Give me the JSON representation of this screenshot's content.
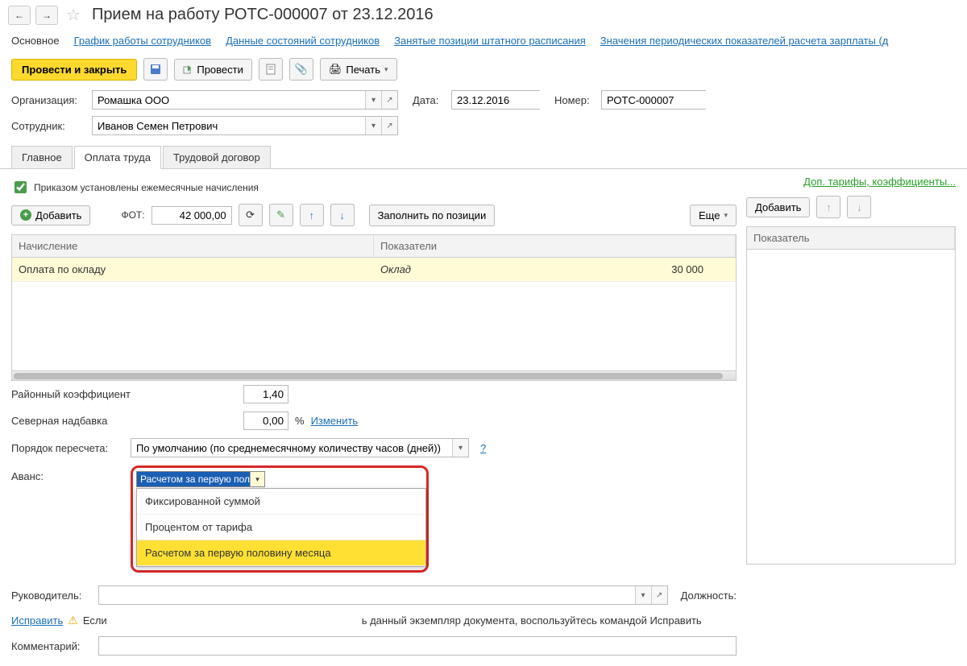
{
  "header": {
    "title": "Прием на работу РОТС-000007 от 23.12.2016"
  },
  "navtabs": {
    "main": "Основное",
    "link1": "График работы сотрудников",
    "link2": "Данные состояний сотрудников",
    "link3": "Занятые позиции штатного расписания",
    "link4": "Значения периодических показателей расчета зарплаты (д"
  },
  "cmdbar": {
    "post_close": "Провести и закрыть",
    "post": "Провести",
    "print": "Печать"
  },
  "form": {
    "org_lbl": "Организация:",
    "org_val": "Ромашка ООО",
    "date_lbl": "Дата:",
    "date_val": "23.12.2016",
    "num_lbl": "Номер:",
    "num_val": "РОТС-000007",
    "emp_lbl": "Сотрудник:",
    "emp_val": "Иванов Семен Петрович"
  },
  "tabs": {
    "t1": "Главное",
    "t2": "Оплата труда",
    "t3": "Трудовой договор"
  },
  "pay": {
    "chk_label": "Приказом установлены ежемесячные начисления",
    "add": "Добавить",
    "fot_lbl": "ФОТ:",
    "fot_val": "42 000,00",
    "fill": "Заполнить по позиции",
    "more": "Еще",
    "dop": "Доп. тарифы, коэффициенты...",
    "add2": "Добавить",
    "col1": "Начисление",
    "col2": "Показатели",
    "col3": "Показатель",
    "row_nach": "Оплата по окладу",
    "row_pok": "Оклад",
    "row_val": "30 000"
  },
  "bottom": {
    "rk_lbl": "Районный коэффициент",
    "rk_val": "1,40",
    "sn_lbl": "Северная надбавка",
    "sn_val": "0,00",
    "pct": "%",
    "change": "Изменить",
    "recalc_lbl": "Порядок пересчета:",
    "recalc_val": "По умолчанию (по среднемесячному количеству часов (дней))",
    "avans_lbl": "Аванс:",
    "avans_sel": "Расчетом за первую поло",
    "dd1": "Фиксированной суммой",
    "dd2": "Процентом от тарифа",
    "dd3": "Расчетом за первую половину месяца",
    "ruk_lbl": "Руководитель:",
    "dolzh_lbl": "Должность:",
    "fix": "Исправить",
    "warn": "Если",
    "warn2": "ь данный экземпляр документа, воспользуйтесь командой Исправить",
    "comment_lbl": "Комментарий:"
  }
}
